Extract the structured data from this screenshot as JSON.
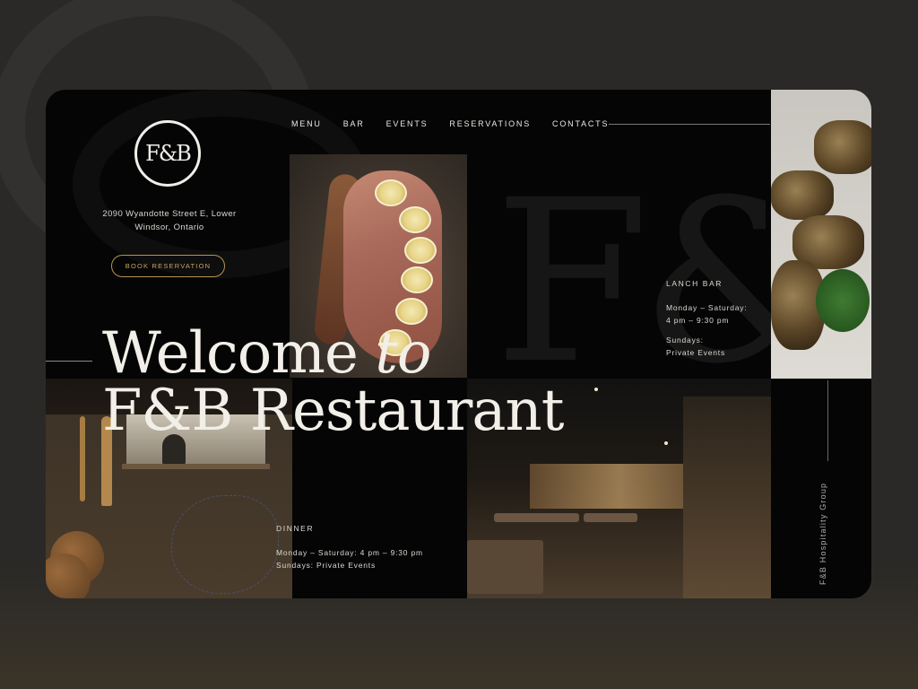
{
  "brand": {
    "logo_text": "F&B",
    "background_monogram": "F&B",
    "group_name": "F&B Hospitality Group"
  },
  "address": {
    "line1": "2090 Wyandotte Street E, Lower",
    "line2": "Windsor, Ontario"
  },
  "cta": {
    "book_label": "BOOK RESERVATION"
  },
  "nav": {
    "items": [
      {
        "label": "MENU"
      },
      {
        "label": "BAR"
      },
      {
        "label": "EVENTS"
      },
      {
        "label": "RESERVATIONS"
      },
      {
        "label": "CONTACTS"
      }
    ]
  },
  "hero": {
    "line1_word": "Welcome",
    "line1_italic": "to",
    "line2": "F&B Restaurant"
  },
  "lanch_bar": {
    "heading": "LANCH BAR",
    "line1": "Monday – Saturday:",
    "line2": "4 pm – 9:30 pm",
    "line3": "Sundays:",
    "line4": "Private Events"
  },
  "dinner": {
    "heading": "DINNER",
    "line1": "Monday – Saturday: 4 pm – 9:30 pm",
    "line2": "Sundays: Private Events"
  },
  "colors": {
    "background": "#2a2927",
    "card": "#050505",
    "accent_gold": "#c9a562",
    "text": "#f2efe9"
  }
}
